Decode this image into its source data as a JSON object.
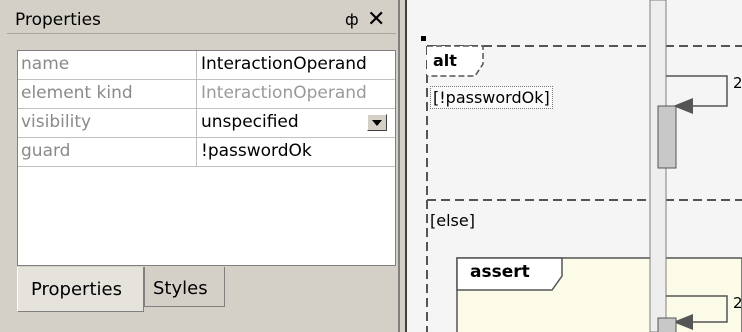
{
  "panel": {
    "title": "Properties",
    "pin_glyph": "ф",
    "close_glyph": "✕",
    "rows": [
      {
        "key": "name",
        "value": "InteractionOperand",
        "readonly": false
      },
      {
        "key": "element kind",
        "value": "InteractionOperand",
        "readonly": true
      },
      {
        "key": "visibility",
        "value": "unspecified",
        "readonly": false,
        "dropdown": true
      },
      {
        "key": "guard",
        "value": "!passwordOk",
        "readonly": false
      }
    ],
    "tabs": [
      "Properties",
      "Styles"
    ]
  },
  "diagram": {
    "fragment_alt": "alt",
    "guard_alt": "[!passwordOk]",
    "guard_else": "[else]",
    "fragment_assert": "assert",
    "message_num_1": "2",
    "message_num_2": "2"
  },
  "colors": {
    "panel_bg": "#d4d0c8",
    "diagram_bg": "#f5f5f5",
    "assert_bg": "#fbfbe8",
    "activation": "#c8c8c8"
  }
}
